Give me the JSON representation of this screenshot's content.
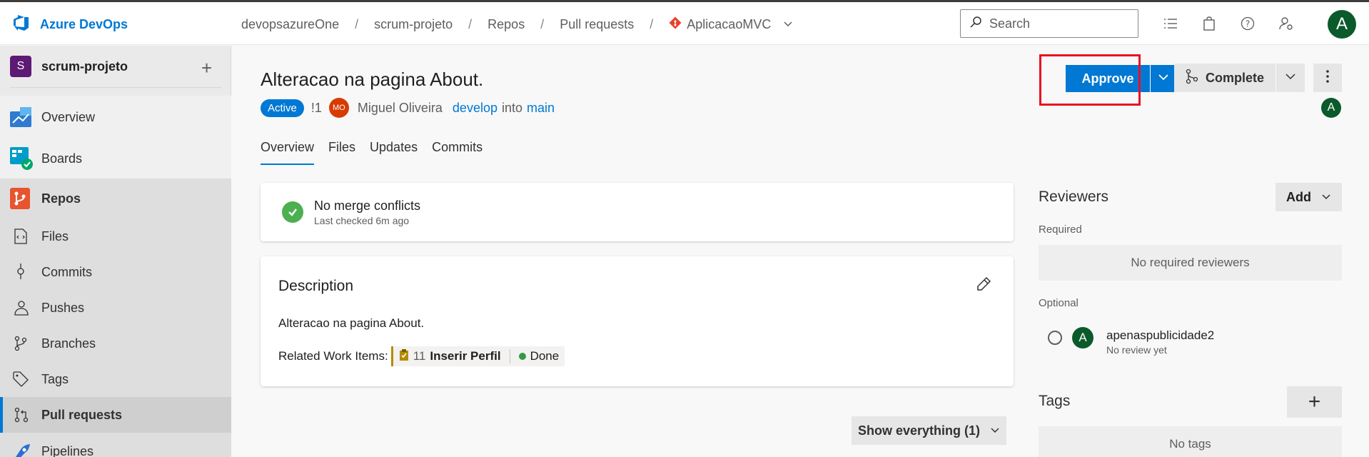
{
  "app": {
    "name": "Azure DevOps"
  },
  "breadcrumb": {
    "org": "devopsazureOne",
    "project": "scrum-projeto",
    "section": "Repos",
    "page": "Pull requests",
    "repo": "AplicacaoMVC",
    "separator": "/"
  },
  "search": {
    "placeholder": "Search"
  },
  "user": {
    "initial": "A"
  },
  "sidebar": {
    "project_initial": "S",
    "project_name": "scrum-projeto",
    "items": [
      {
        "label": "Overview",
        "icon": "overview-icon"
      },
      {
        "label": "Boards",
        "icon": "boards-icon"
      },
      {
        "label": "Repos",
        "icon": "repos-icon"
      },
      {
        "label": "Files",
        "icon": "files-icon"
      },
      {
        "label": "Commits",
        "icon": "commits-icon"
      },
      {
        "label": "Pushes",
        "icon": "pushes-icon"
      },
      {
        "label": "Branches",
        "icon": "branches-icon"
      },
      {
        "label": "Tags",
        "icon": "tags-icon"
      },
      {
        "label": "Pull requests",
        "icon": "pull-requests-icon"
      },
      {
        "label": "Pipelines",
        "icon": "pipelines-icon"
      }
    ]
  },
  "pr": {
    "title": "Alteracao na pagina About.",
    "status": "Active",
    "id": "!1",
    "author_initials": "MO",
    "author": "Miguel Oliveira",
    "source_branch": "develop",
    "into": "into",
    "target_branch": "main"
  },
  "tabs": [
    "Overview",
    "Files",
    "Updates",
    "Commits"
  ],
  "actions": {
    "approve": "Approve",
    "complete": "Complete"
  },
  "merge": {
    "title": "No merge conflicts",
    "subtitle": "Last checked 6m ago"
  },
  "description": {
    "heading": "Description",
    "text": "Alteracao na pagina About.",
    "related_label": "Related Work Items:",
    "work_item": {
      "id": "11",
      "title": "Inserir Perfil",
      "state": "Done"
    }
  },
  "show_filter": "Show everything (1)",
  "reviewers": {
    "heading": "Reviewers",
    "add_label": "Add",
    "required_label": "Required",
    "required_empty": "No required reviewers",
    "optional_label": "Optional",
    "optional": [
      {
        "initial": "A",
        "name": "apenaspublicidade2",
        "status": "No review yet"
      }
    ]
  },
  "tags": {
    "heading": "Tags",
    "empty": "No tags"
  },
  "colors": {
    "accent": "#0078d4",
    "success": "#4caf50",
    "highlight": "#e81123"
  }
}
